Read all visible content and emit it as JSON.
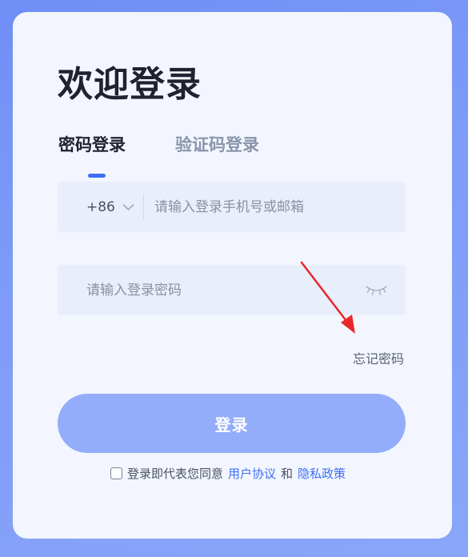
{
  "page": {
    "title": "欢迎登录"
  },
  "tabs": [
    {
      "label": "密码登录",
      "active": true
    },
    {
      "label": "验证码登录",
      "active": false
    }
  ],
  "phone_field": {
    "country_code": "+86",
    "placeholder": "请输入登录手机号或邮箱",
    "value": ""
  },
  "password_field": {
    "placeholder": "请输入登录密码",
    "value": ""
  },
  "forgot_password": "忘记密码",
  "login_button": "登录",
  "agreement": {
    "checked": false,
    "prefix": "登录即代表您同意",
    "terms_link": "用户协议",
    "and": "和",
    "privacy_link": "隐私政策"
  },
  "colors": {
    "background": "#7d9bf8",
    "card": "#f3f6fe",
    "accent": "#3d6ef6",
    "button": "#93adfb",
    "annotation_arrow": "#e8282b"
  },
  "icons": {
    "country_dropdown": "chevron-down-icon",
    "password_visibility": "eye-closed-icon",
    "annotation": "red-arrow-icon"
  }
}
